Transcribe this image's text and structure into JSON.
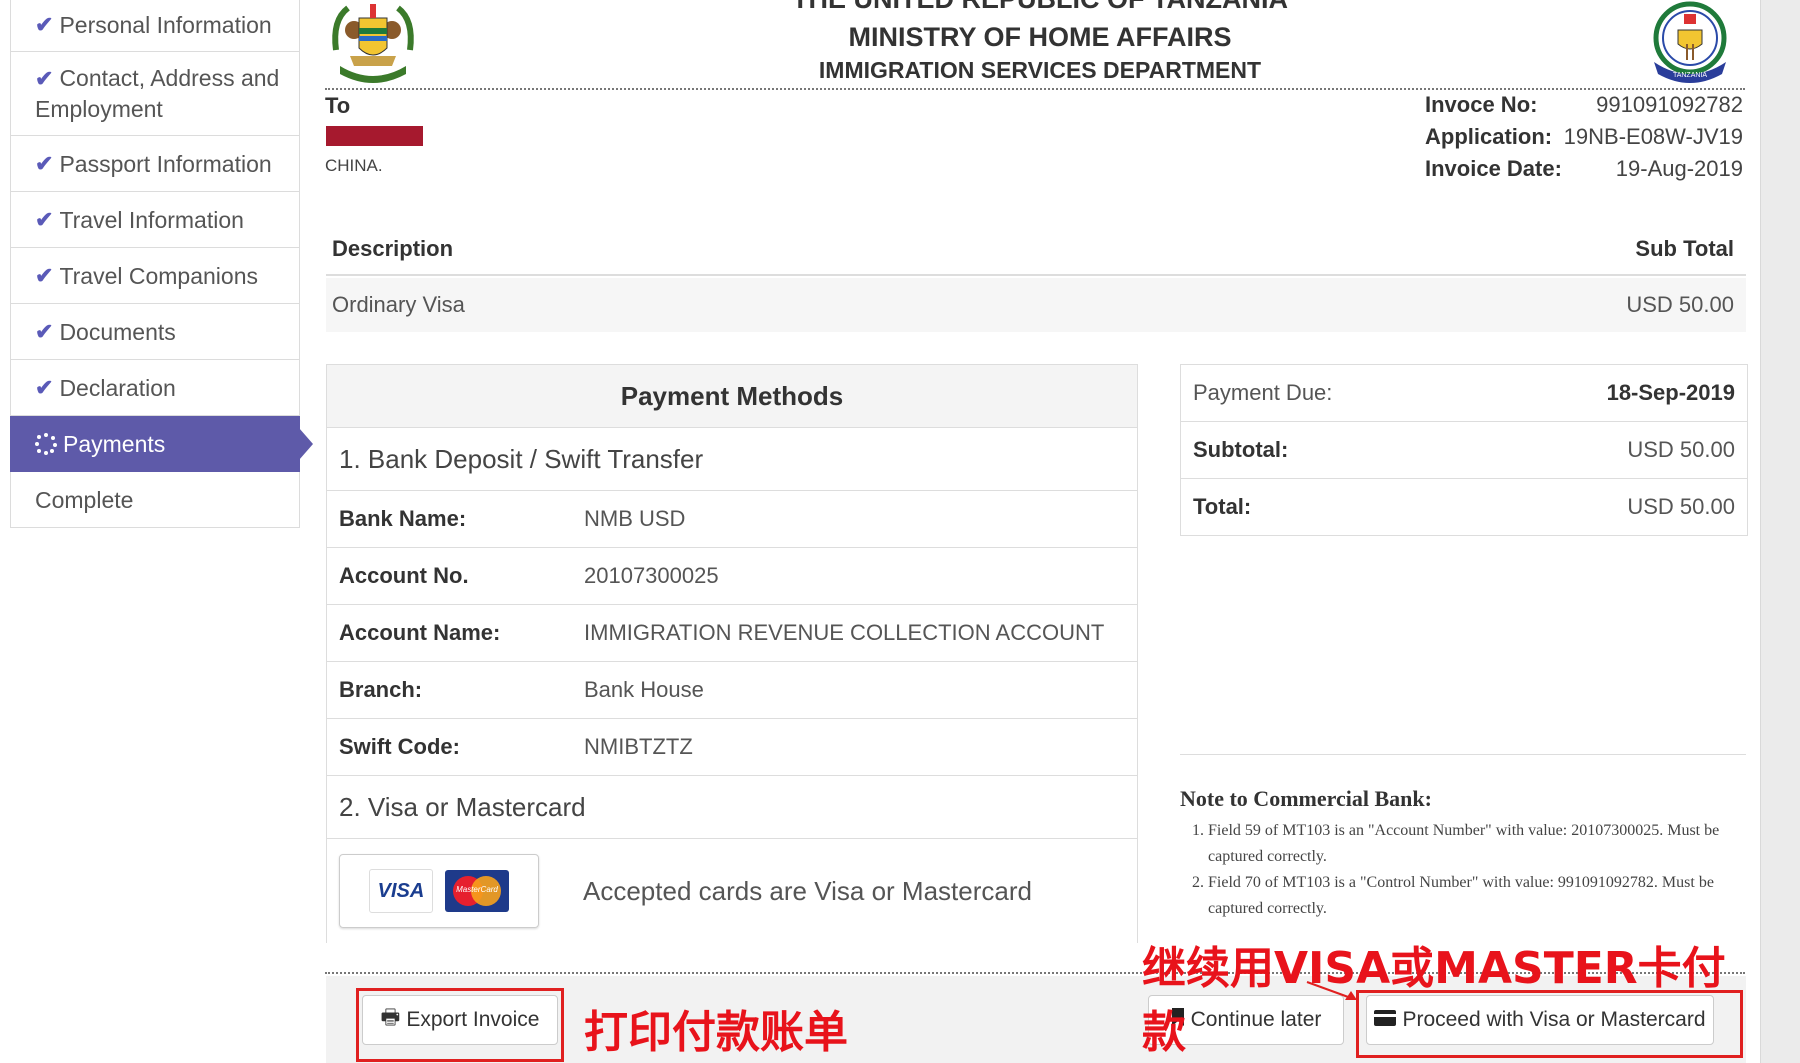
{
  "sidebar": {
    "items": [
      {
        "label": "Personal Information",
        "state": "done"
      },
      {
        "label": "Contact, Address and Employment",
        "state": "done"
      },
      {
        "label": "Passport Information",
        "state": "done"
      },
      {
        "label": "Travel Information",
        "state": "done"
      },
      {
        "label": "Travel Companions",
        "state": "done"
      },
      {
        "label": "Documents",
        "state": "done"
      },
      {
        "label": "Declaration",
        "state": "done"
      },
      {
        "label": "Payments",
        "state": "active"
      },
      {
        "label": "Complete",
        "state": "pending"
      }
    ]
  },
  "header": {
    "line1": "THE UNITED REPUBLIC OF TANZANIA",
    "line2": "MINISTRY OF HOME AFFAIRS",
    "line3": "IMMIGRATION SERVICES DEPARTMENT",
    "logo_text": "TANZANIA"
  },
  "recipient": {
    "to_label": "To",
    "country": "CHINA."
  },
  "invoice": {
    "no_label": "Invoce No:",
    "no": "991091092782",
    "app_label": "Application:",
    "app": "19NB-E08W-JV19",
    "date_label": "Invoice Date:",
    "date": "19-Aug-2019"
  },
  "items_table": {
    "col_description": "Description",
    "col_subtotal": "Sub Total",
    "rows": [
      {
        "description": "Ordinary Visa",
        "subtotal": "USD 50.00"
      }
    ]
  },
  "payment_methods": {
    "title": "Payment Methods",
    "bank_section": "1. Bank Deposit / Swift Transfer",
    "bank_rows": [
      {
        "label": "Bank Name:",
        "value": "NMB USD"
      },
      {
        "label": "Account No.",
        "value": "20107300025"
      },
      {
        "label": "Account Name:",
        "value": "IMMIGRATION REVENUE COLLECTION ACCOUNT"
      },
      {
        "label": "Branch:",
        "value": "Bank House"
      },
      {
        "label": "Swift Code:",
        "value": "NMIBTZTZ"
      }
    ],
    "card_section": "2. Visa or Mastercard",
    "visa_text": "VISA",
    "mastercard_text": "MasterCard",
    "cards_text": "Accepted cards are Visa or Mastercard"
  },
  "summary": {
    "due_label": "Payment Due:",
    "due": "18-Sep-2019",
    "subtotal_label": "Subtotal:",
    "subtotal": "USD 50.00",
    "total_label": "Total:",
    "total": "USD 50.00"
  },
  "note": {
    "title": "Note to Commercial Bank:",
    "items": [
      "Field 59 of MT103 is an \"Account Number\" with value: 20107300025. Must be captured correctly.",
      "Field 70 of MT103 is a \"Control Number\" with value: 991091092782. Must be captured correctly."
    ]
  },
  "actions": {
    "export": "Export Invoice",
    "continue_later": "Continue later",
    "proceed": "Proceed with Visa or Mastercard"
  },
  "annotations": {
    "export_note": "打印付款账单",
    "proceed_note": "继续用VISA或MASTER卡付款"
  },
  "colors": {
    "accent": "#5e5aa9",
    "annotation_red": "#e02020",
    "redaction": "#a6192e"
  }
}
